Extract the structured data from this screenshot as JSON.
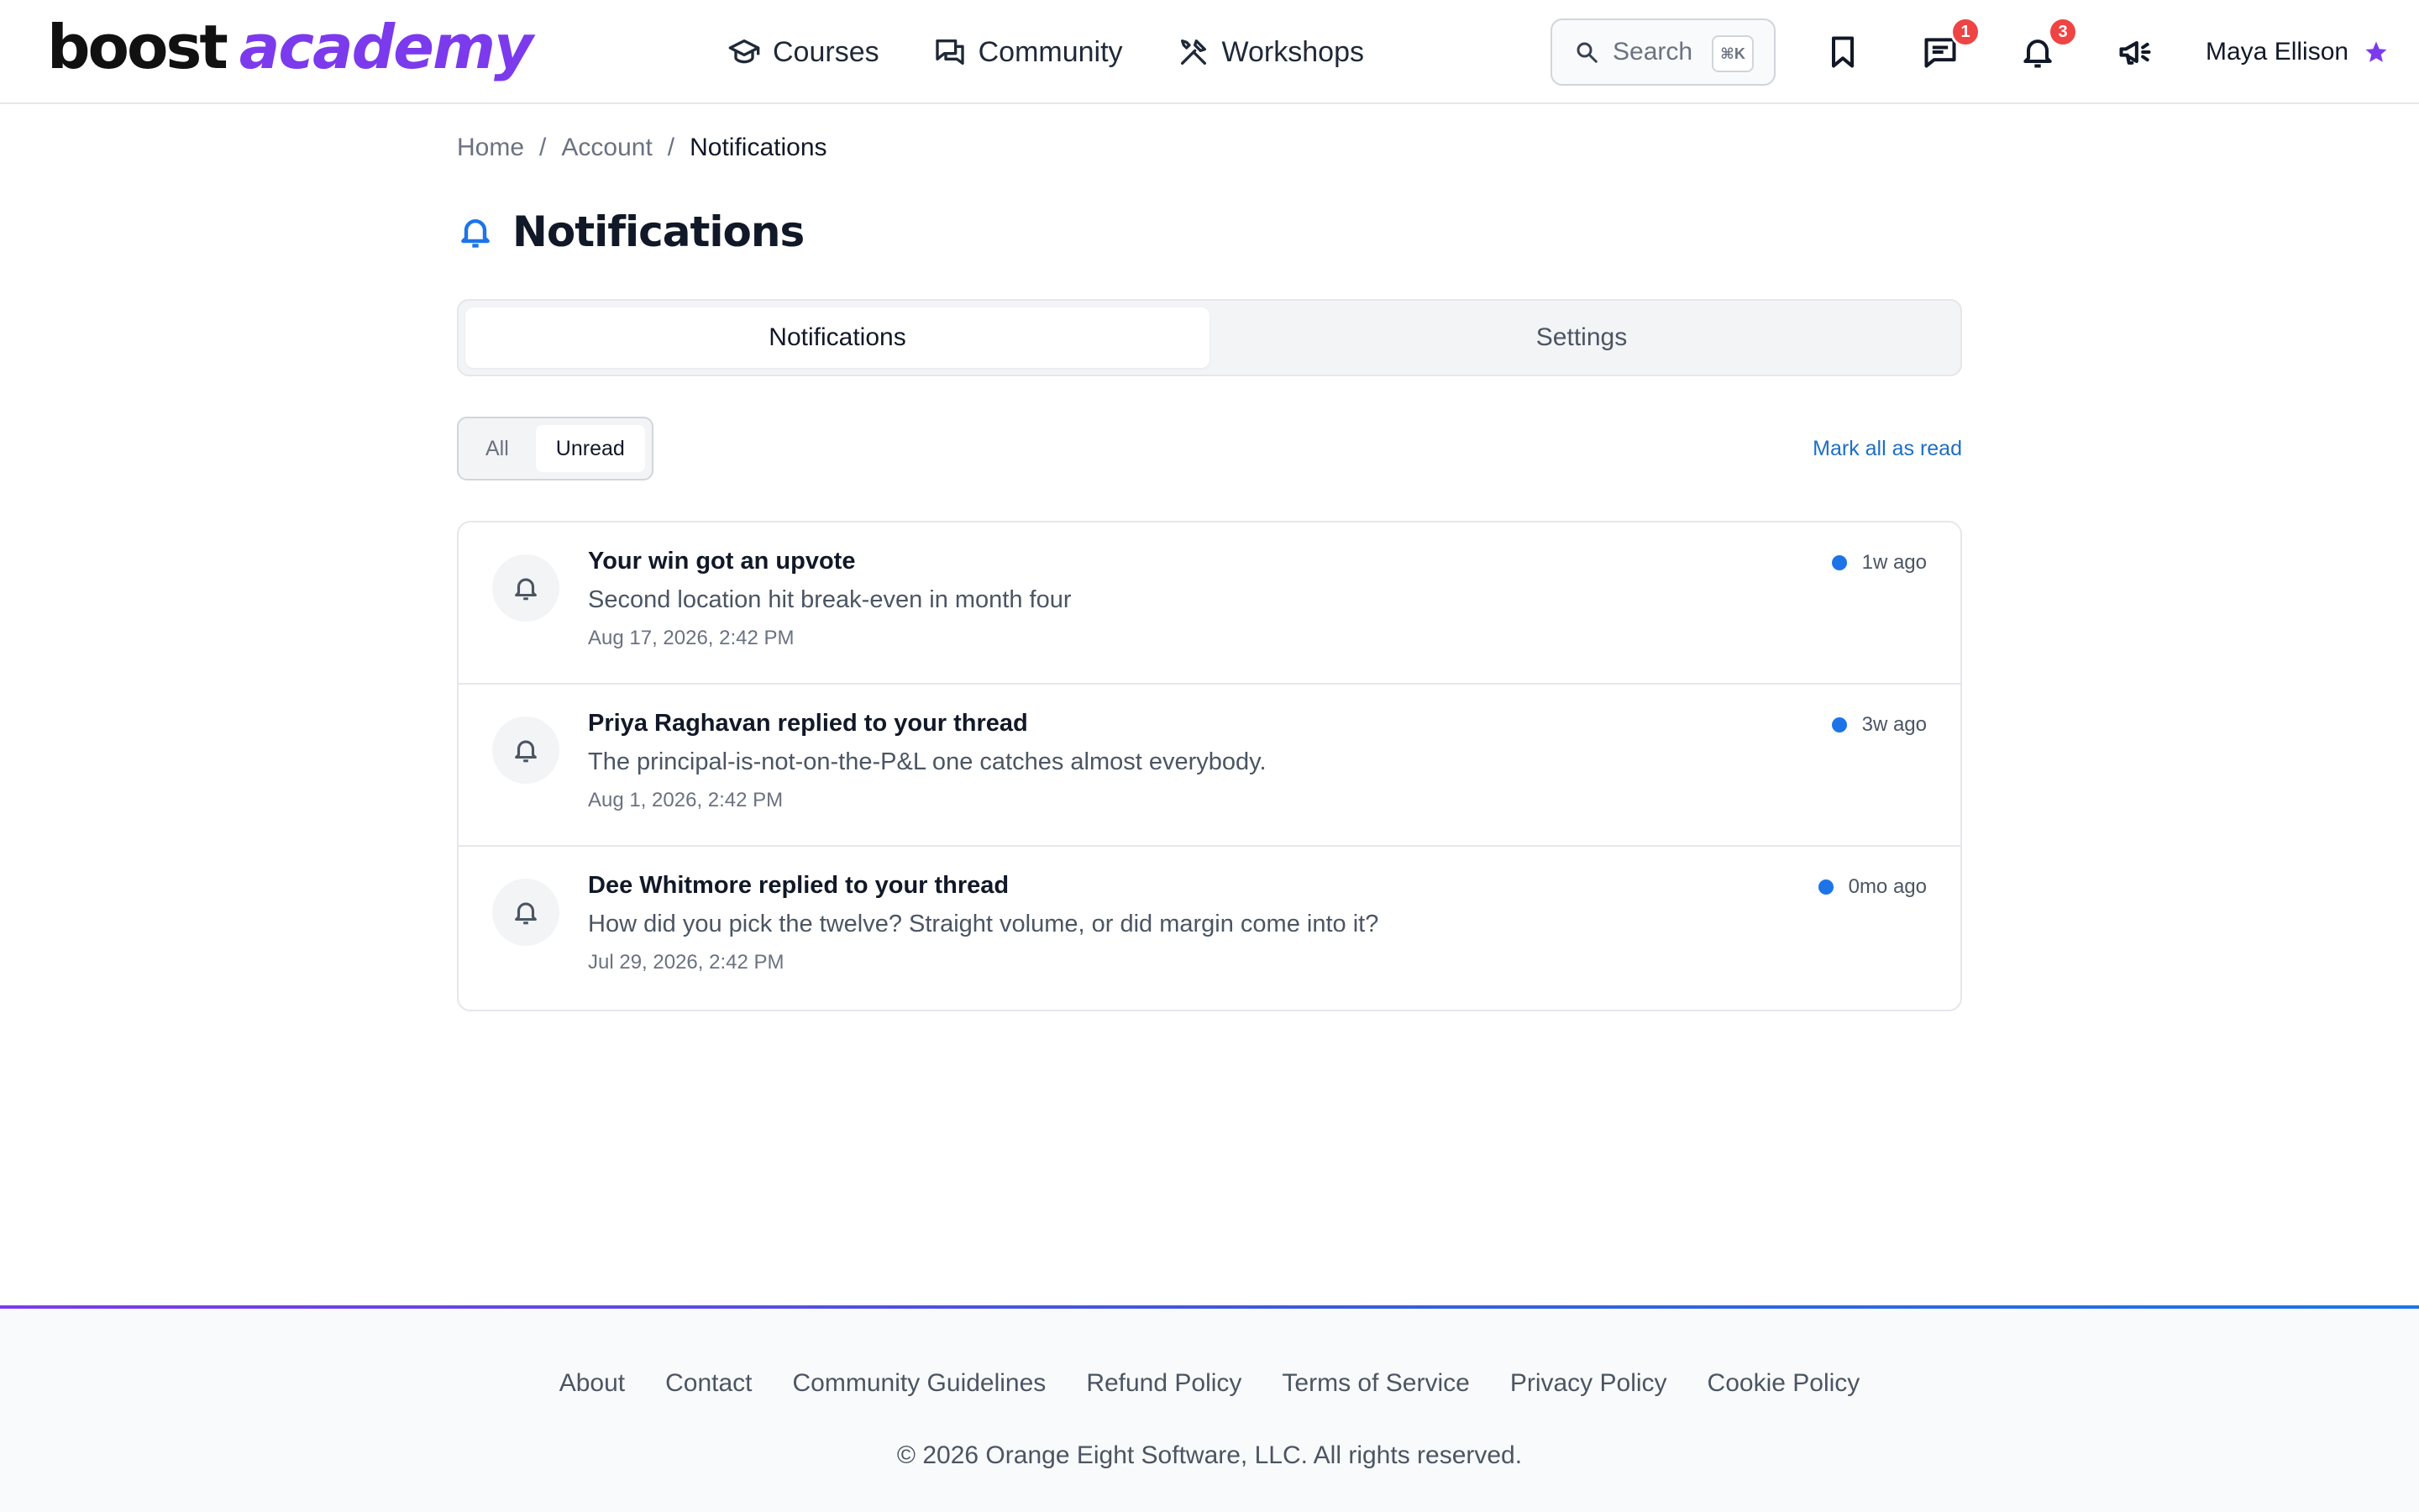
{
  "brand": {
    "part1": "boost",
    "part2": "academy"
  },
  "nav": [
    {
      "label": "Courses",
      "icon": "graduation-cap-icon"
    },
    {
      "label": "Community",
      "icon": "chat-bubbles-icon"
    },
    {
      "label": "Workshops",
      "icon": "tools-icon"
    }
  ],
  "search": {
    "placeholder": "Search",
    "shortcut": "⌘K"
  },
  "header_icons": {
    "bookmarks": {
      "icon": "bookmark-icon"
    },
    "messages": {
      "icon": "message-icon",
      "badge": "1"
    },
    "notifications": {
      "icon": "bell-icon",
      "badge": "3"
    },
    "announcements": {
      "icon": "megaphone-icon"
    }
  },
  "user": {
    "name": "Maya Ellison",
    "icon": "star-icon"
  },
  "breadcrumb": [
    "Home",
    "Account",
    "Notifications"
  ],
  "page": {
    "title": "Notifications"
  },
  "tabs": [
    {
      "label": "Notifications",
      "active": true
    },
    {
      "label": "Settings",
      "active": false
    }
  ],
  "filter": {
    "options": [
      {
        "label": "All",
        "active": false
      },
      {
        "label": "Unread",
        "active": true
      }
    ],
    "mark_all_label": "Mark all as read"
  },
  "notifications": [
    {
      "title": "Your win got an upvote",
      "body": "Second location hit break-even in month four",
      "date": "Aug 17, 2026, 2:42 PM",
      "relative": "1w ago",
      "unread": true
    },
    {
      "title": "Priya Raghavan replied to your thread",
      "body": "The principal-is-not-on-the-P&L one catches almost everybody.",
      "date": "Aug 1, 2026, 2:42 PM",
      "relative": "3w ago",
      "unread": true
    },
    {
      "title": "Dee Whitmore replied to your thread",
      "body": "How did you pick the twelve? Straight volume, or did margin come into it?",
      "date": "Jul 29, 2026, 2:42 PM",
      "relative": "0mo ago",
      "unread": true
    }
  ],
  "footer": {
    "links": [
      "About",
      "Contact",
      "Community Guidelines",
      "Refund Policy",
      "Terms of Service",
      "Privacy Policy",
      "Cookie Policy"
    ],
    "copyright": "© 2026 Orange Eight Software, LLC. All rights reserved."
  },
  "colors": {
    "brand_purple": "#7c3aed",
    "link_blue": "#1d6fc4",
    "unread_dot": "#1d74e7",
    "badge_red": "#ef4444"
  }
}
